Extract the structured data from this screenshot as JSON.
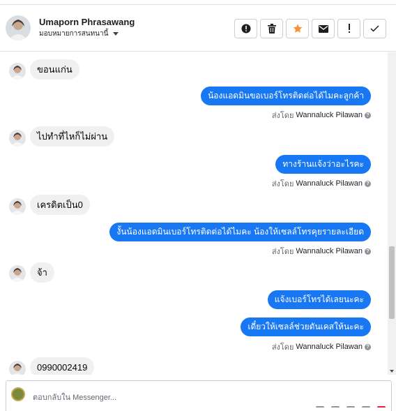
{
  "header": {
    "name": "Umaporn Phrasawang",
    "assign_label": "มอบหมายการสนทนานี้"
  },
  "actions": [
    {
      "icon": "alert-circle-icon",
      "name": "mark-spam-button"
    },
    {
      "icon": "trash-icon",
      "name": "delete-button"
    },
    {
      "icon": "star-icon",
      "name": "star-button"
    },
    {
      "icon": "envelope-icon",
      "name": "mark-unread-button"
    },
    {
      "icon": "exclamation-icon",
      "name": "follow-up-button"
    },
    {
      "icon": "check-icon",
      "name": "mark-done-button"
    }
  ],
  "sent_by_label": "ส่งโดย",
  "messages": [
    {
      "dir": "in",
      "text": "ขอนแก่น"
    },
    {
      "dir": "out",
      "text": "น้องแอดมินขอเบอร์โทรติดต่อได้ไมคะลูกค้า",
      "sender": "Wannaluck Pilawan"
    },
    {
      "dir": "in",
      "text": "ไปทำที่ไหก็ไม่ผ่าน"
    },
    {
      "dir": "out",
      "text": "ทางร้านแจ้งว่าอะไรคะ",
      "sender": "Wannaluck Pilawan"
    },
    {
      "dir": "in",
      "text": "เครดิตเป็น0"
    },
    {
      "dir": "out",
      "text": "งั้นน้องแอดมินเบอร์โทรติดต่อได้ไมคะ น้องให้เซลล์โทรคุยรายละเอียด",
      "sender": "Wannaluck Pilawan"
    },
    {
      "dir": "in",
      "text": "จ้า"
    },
    {
      "dir": "out",
      "text": "แจ้งเบอร์โทรได้เลยนะคะ"
    },
    {
      "dir": "out",
      "text": "เดี๋ยวให้เซลล์ช่วยดันเคสให้นะคะ",
      "sender": "Wannaluck Pilawan"
    },
    {
      "dir": "in",
      "text": "0990002419"
    }
  ],
  "composer": {
    "placeholder": "ตอบกลับใน Messenger..."
  },
  "colors": {
    "outgoing_bubble": "#1877f2",
    "incoming_bubble": "#f0f0f0",
    "star": "#f7923a"
  }
}
